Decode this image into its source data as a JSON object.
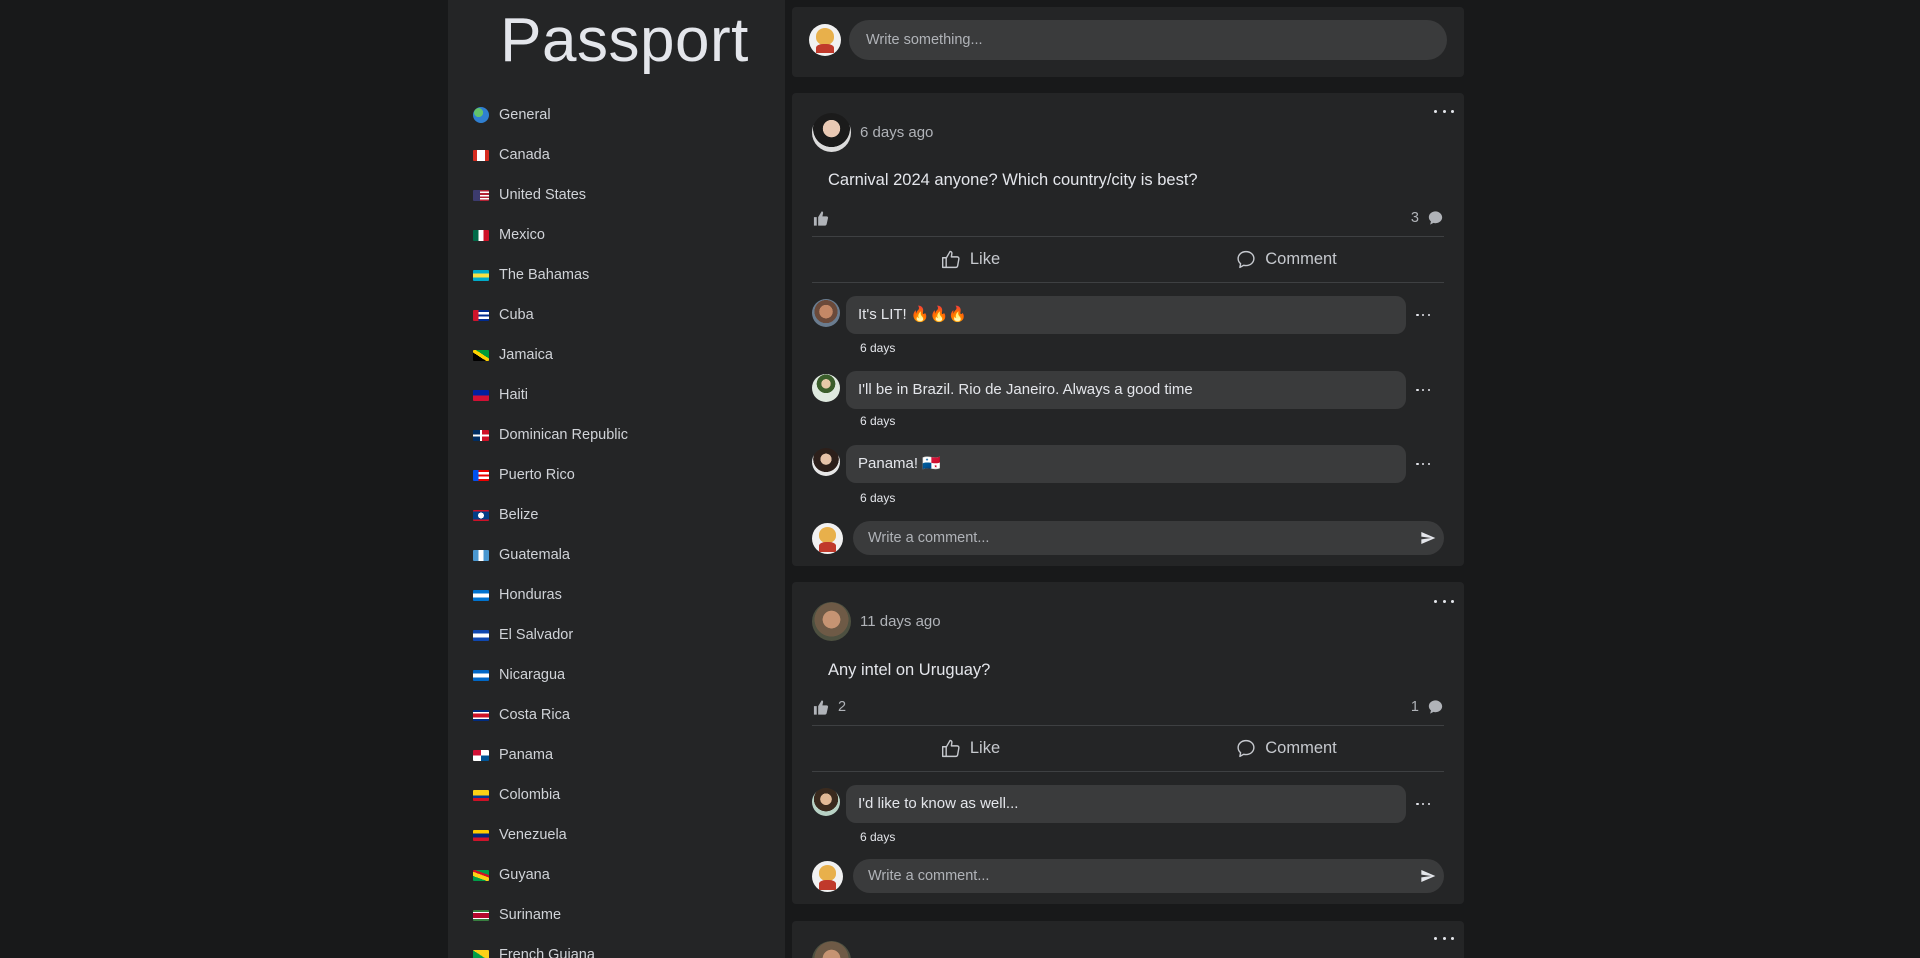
{
  "app": {
    "brand": "Passport"
  },
  "sidebar": {
    "items": [
      {
        "label": "General",
        "icon": "globe-icon"
      },
      {
        "label": "Canada",
        "icon": "flag-canada-icon"
      },
      {
        "label": "United States",
        "icon": "flag-united-states-icon"
      },
      {
        "label": "Mexico",
        "icon": "flag-mexico-icon"
      },
      {
        "label": "The Bahamas",
        "icon": "flag-bahamas-icon"
      },
      {
        "label": "Cuba",
        "icon": "flag-cuba-icon"
      },
      {
        "label": "Jamaica",
        "icon": "flag-jamaica-icon"
      },
      {
        "label": "Haiti",
        "icon": "flag-haiti-icon"
      },
      {
        "label": "Dominican Republic",
        "icon": "flag-dominican-republic-icon"
      },
      {
        "label": "Puerto Rico",
        "icon": "flag-puerto-rico-icon"
      },
      {
        "label": "Belize",
        "icon": "flag-belize-icon"
      },
      {
        "label": "Guatemala",
        "icon": "flag-guatemala-icon"
      },
      {
        "label": "Honduras",
        "icon": "flag-honduras-icon"
      },
      {
        "label": "El Salvador",
        "icon": "flag-el-salvador-icon"
      },
      {
        "label": "Nicaragua",
        "icon": "flag-nicaragua-icon"
      },
      {
        "label": "Costa Rica",
        "icon": "flag-costa-rica-icon"
      },
      {
        "label": "Panama",
        "icon": "flag-panama-icon"
      },
      {
        "label": "Colombia",
        "icon": "flag-colombia-icon"
      },
      {
        "label": "Venezuela",
        "icon": "flag-venezuela-icon"
      },
      {
        "label": "Guyana",
        "icon": "flag-guyana-icon"
      },
      {
        "label": "Suriname",
        "icon": "flag-suriname-icon"
      },
      {
        "label": "French Guiana",
        "icon": "flag-french-guiana-icon"
      }
    ]
  },
  "composer": {
    "placeholder": "Write something..."
  },
  "posts": [
    {
      "time": "6 days ago",
      "text": "Carnival 2024 anyone? Which country/city is best?",
      "like_count": "",
      "comment_count": "3",
      "like_label": "Like",
      "comment_label": "Comment",
      "comments": [
        {
          "text": "It's LIT! 🔥🔥🔥",
          "time": "6 days"
        },
        {
          "text": "I'll be in Brazil. Rio de Janeiro. Always a good time",
          "time": "6 days"
        },
        {
          "text": "Panama! 🇵🇦",
          "time": "6 days"
        }
      ],
      "reply_placeholder": "Write a comment..."
    },
    {
      "time": "11 days ago",
      "text": "Any intel on Uruguay?",
      "like_count": "2",
      "comment_count": "1",
      "like_label": "Like",
      "comment_label": "Comment",
      "comments": [
        {
          "text": "I'd like to know as well...",
          "time": "6 days"
        }
      ],
      "reply_placeholder": "Write a comment..."
    }
  ],
  "colors": {
    "background": "#18191a",
    "card": "#242526",
    "input": "#3a3b3c",
    "text": "#e4e6eb",
    "muted": "#b0b3b8"
  }
}
